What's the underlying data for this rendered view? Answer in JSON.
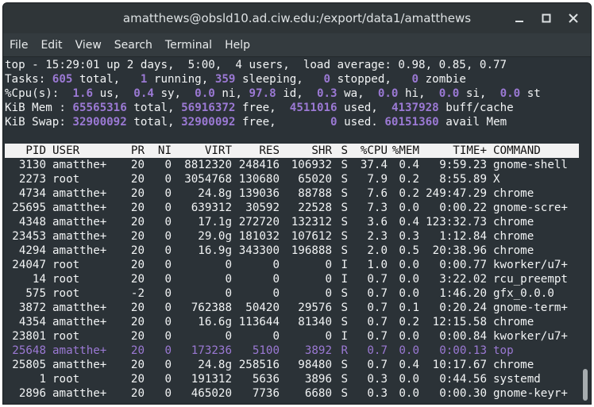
{
  "window": {
    "title": "amatthews@obsld10.ad.ciw.edu:/export/data1/amatthews"
  },
  "menu": [
    "File",
    "Edit",
    "View",
    "Search",
    "Terminal",
    "Help"
  ],
  "summary": {
    "line1": "top - 15:29:01 up 2 days,  5:00,  4 users,  load average: 0.98, 0.85, 0.77",
    "tasks": {
      "prefix": "Tasks: ",
      "total": "605",
      "total_lbl": " total,   ",
      "running": "1",
      "running_lbl": " running, ",
      "sleeping": "359",
      "sleeping_lbl": " sleeping,   ",
      "stopped": "0",
      "stopped_lbl": " stopped,   ",
      "zombie": "0",
      "zombie_lbl": " zombie"
    },
    "cpu": {
      "prefix": "%Cpu(s):  ",
      "us": "1.6",
      "us_lbl": " us,  ",
      "sy": "0.4",
      "sy_lbl": " sy,  ",
      "ni": "0.0",
      "ni_lbl": " ni, ",
      "id": "97.8",
      "id_lbl": " id,  ",
      "wa": "0.3",
      "wa_lbl": " wa,  ",
      "hi": "0.0",
      "hi_lbl": " hi,  ",
      "si": "0.0",
      "si_lbl": " si,  ",
      "st": "0.0",
      "st_lbl": " st"
    },
    "mem": {
      "prefix": "KiB Mem : ",
      "total": "65565316",
      "total_lbl": " total, ",
      "free": "56916372",
      "free_lbl": " free,  ",
      "used": "4511016",
      "used_lbl": " used,  ",
      "buff": "4137928",
      "buff_lbl": " buff/cache"
    },
    "swap": {
      "prefix": "KiB Swap: ",
      "total": "32900092",
      "total_lbl": " total, ",
      "free": "32900092",
      "free_lbl": " free,        ",
      "used": "0",
      "used_lbl": " used. ",
      "avail": "60151360",
      "avail_lbl": " avail Mem"
    }
  },
  "columns": [
    "PID",
    "USER",
    "PR",
    "NI",
    "VIRT",
    "RES",
    "SHR",
    "S",
    "%CPU",
    "%MEM",
    "TIME+",
    "COMMAND"
  ],
  "processes": [
    [
      "3130",
      "amatthe+",
      "20",
      "0",
      "8812320",
      "248416",
      "106932",
      "S",
      "37.4",
      "0.4",
      "9:59.23",
      "gnome-shell"
    ],
    [
      "2273",
      "root",
      "20",
      "0",
      "3054768",
      "130680",
      "65020",
      "S",
      "7.9",
      "0.2",
      "8:55.89",
      "X"
    ],
    [
      "4734",
      "amatthe+",
      "20",
      "0",
      "24.8g",
      "139036",
      "88788",
      "S",
      "7.6",
      "0.2",
      "249:47.29",
      "chrome"
    ],
    [
      "25695",
      "amatthe+",
      "20",
      "0",
      "639312",
      "30592",
      "22528",
      "S",
      "7.3",
      "0.0",
      "0:00.22",
      "gnome-scre+"
    ],
    [
      "4348",
      "amatthe+",
      "20",
      "0",
      "17.1g",
      "272720",
      "132312",
      "S",
      "3.6",
      "0.4",
      "123:32.73",
      "chrome"
    ],
    [
      "23453",
      "amatthe+",
      "20",
      "0",
      "29.0g",
      "181032",
      "107612",
      "S",
      "2.3",
      "0.3",
      "1:12.84",
      "chrome"
    ],
    [
      "4294",
      "amatthe+",
      "20",
      "0",
      "16.9g",
      "343300",
      "196888",
      "S",
      "2.0",
      "0.5",
      "20:38.96",
      "chrome"
    ],
    [
      "24047",
      "root",
      "20",
      "0",
      "0",
      "0",
      "0",
      "I",
      "1.0",
      "0.0",
      "0:00.77",
      "kworker/u7+"
    ],
    [
      "14",
      "root",
      "20",
      "0",
      "0",
      "0",
      "0",
      "I",
      "0.7",
      "0.0",
      "3:22.02",
      "rcu_preempt"
    ],
    [
      "575",
      "root",
      "-2",
      "0",
      "0",
      "0",
      "0",
      "S",
      "0.7",
      "0.0",
      "1:46.20",
      "gfx_0.0.0"
    ],
    [
      "3872",
      "amatthe+",
      "20",
      "0",
      "762388",
      "50420",
      "29576",
      "S",
      "0.7",
      "0.1",
      "0:20.24",
      "gnome-term+"
    ],
    [
      "4354",
      "amatthe+",
      "20",
      "0",
      "16.6g",
      "113644",
      "81340",
      "S",
      "0.7",
      "0.2",
      "12:15.58",
      "chrome"
    ],
    [
      "23801",
      "root",
      "20",
      "0",
      "0",
      "0",
      "0",
      "I",
      "0.7",
      "0.0",
      "0:00.84",
      "kworker/u7+"
    ],
    [
      "25648",
      "amatthe+",
      "20",
      "0",
      "173236",
      "5100",
      "3892",
      "R",
      "0.7",
      "0.0",
      "0:00.13",
      "top"
    ],
    [
      "25805",
      "amatthe+",
      "20",
      "0",
      "24.8g",
      "258516",
      "98480",
      "S",
      "0.7",
      "0.4",
      "10:17.67",
      "chrome"
    ],
    [
      "1",
      "root",
      "20",
      "0",
      "191312",
      "5636",
      "3896",
      "S",
      "0.3",
      "0.0",
      "0:44.56",
      "systemd"
    ],
    [
      "2896",
      "amatthe+",
      "20",
      "0",
      "465020",
      "7736",
      "6680",
      "S",
      "0.3",
      "0.0",
      "0:00.30",
      "gnome-keyr+"
    ]
  ],
  "highlight_color": "#9b79d4"
}
